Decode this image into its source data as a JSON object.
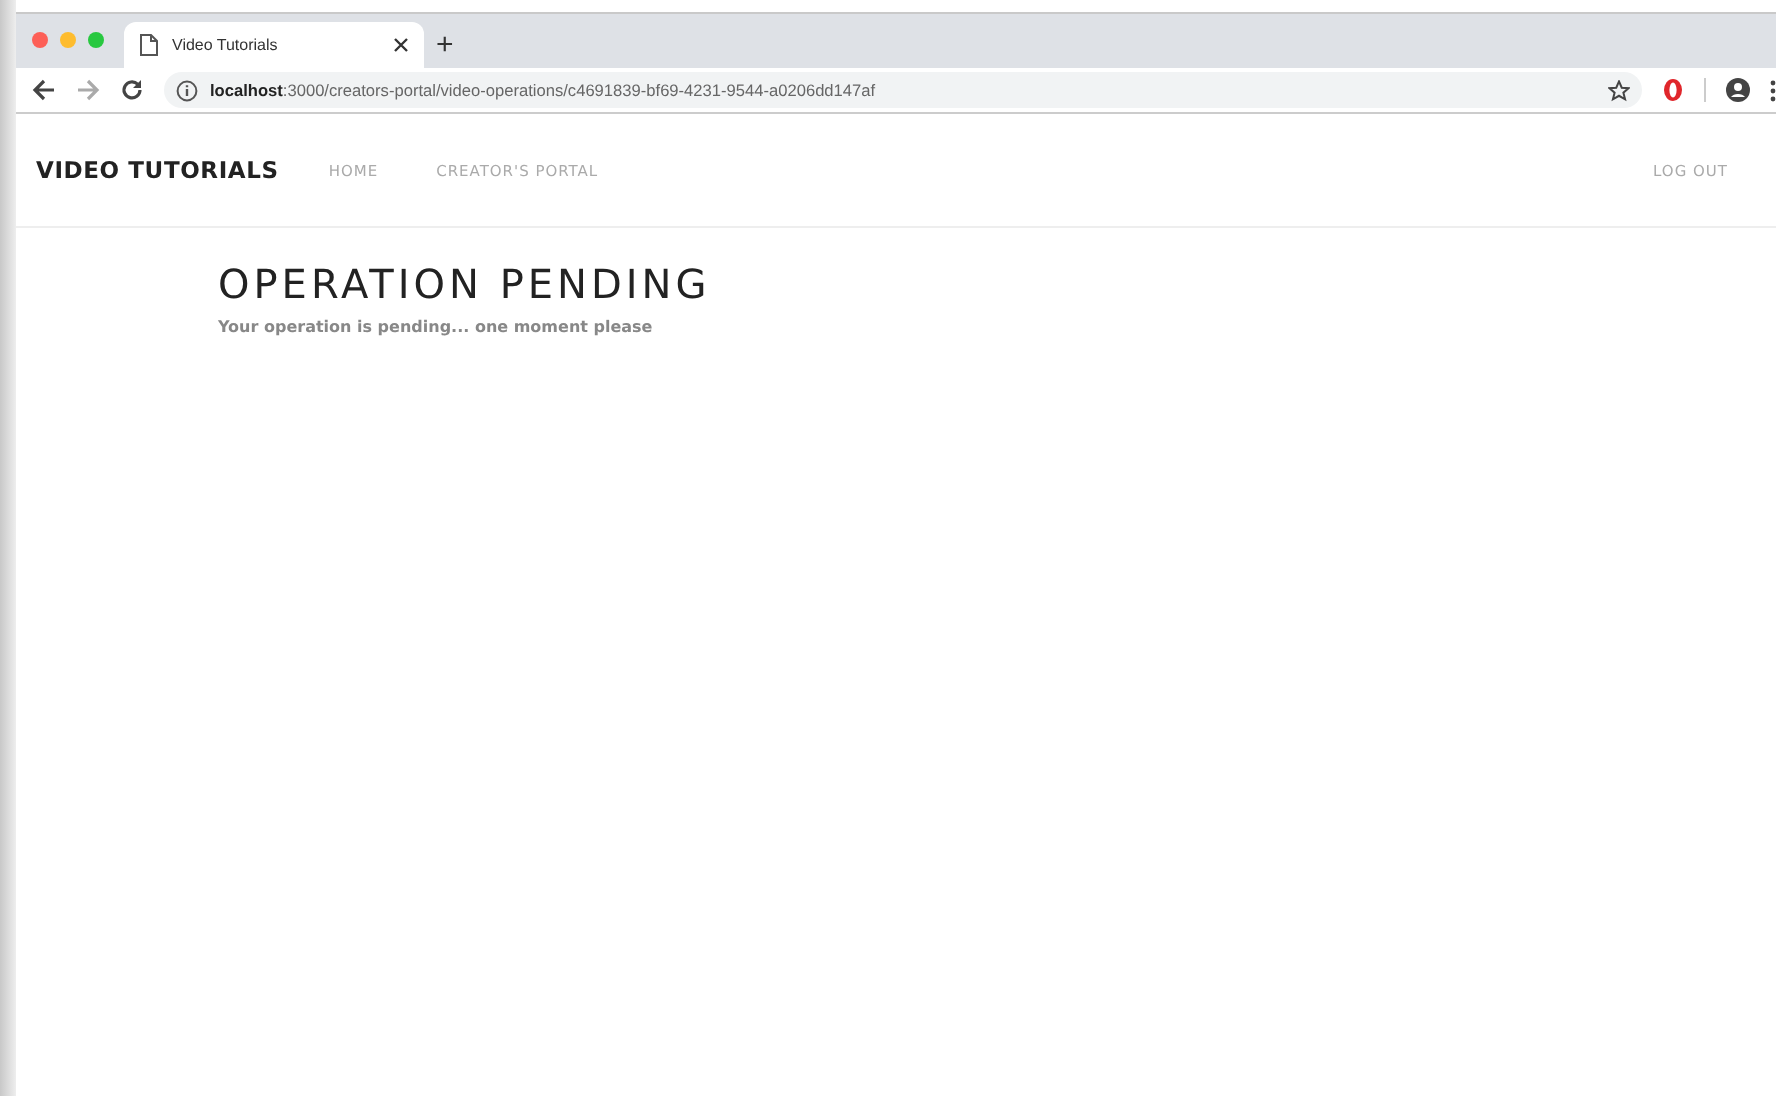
{
  "browser": {
    "tab": {
      "title": "Video Tutorials",
      "selected": true
    },
    "new_tab": "+",
    "address": "**localhost**:3000/creators-portal/video-operations/c4691839-bf69-4231-9544-a0206dd147af"
  },
  "navbar": {
    "brand": "VIDEO TUTORIALS",
    "links": [
      {
        "label": "HOME"
      },
      {
        "label": "CREATOR'S PORTAL"
      }
    ],
    "logout": "LOG OUT"
  },
  "content": {
    "title": "OPERATION PENDING",
    "message": "Your operation is pending... one moment please"
  }
}
